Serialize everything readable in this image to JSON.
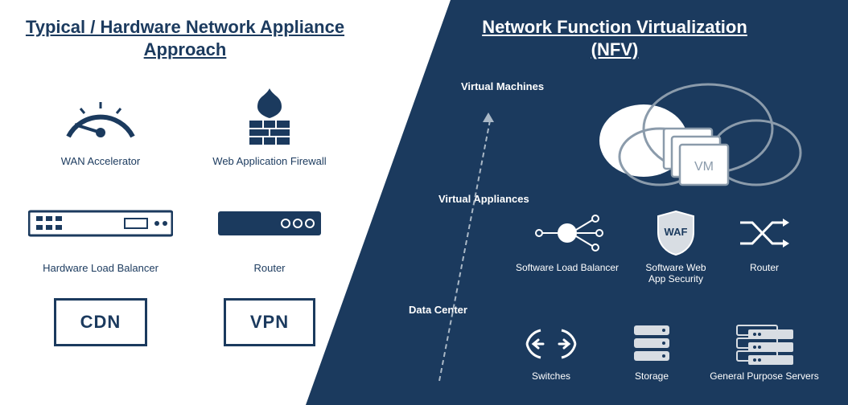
{
  "left": {
    "title": "Typical / Hardware Network Appliance Approach",
    "items": [
      {
        "label": "WAN Accelerator"
      },
      {
        "label": "Web Application Firewall"
      },
      {
        "label": "Hardware Load Balancer"
      },
      {
        "label": "Router"
      },
      {
        "label": "CDN"
      },
      {
        "label": "VPN"
      }
    ]
  },
  "right": {
    "title_line1": "Network Function Virtualization",
    "title_line2": "(NFV)",
    "sections": [
      "Virtual Machines",
      "Virtual Appliances",
      "Data Center"
    ],
    "vm_badge": "VM",
    "waf_badge": "WAF",
    "va_items": [
      {
        "label": "Software Load Balancer"
      },
      {
        "label_l1": "Software Web",
        "label_l2": "App Security"
      },
      {
        "label": "Router"
      }
    ],
    "dc_items": [
      {
        "label": "Switches"
      },
      {
        "label": "Storage"
      },
      {
        "label": "General Purpose Servers"
      }
    ]
  }
}
